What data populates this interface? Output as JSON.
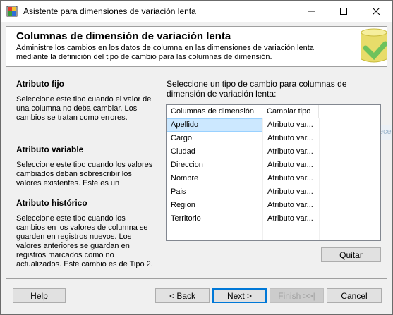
{
  "window": {
    "title": "Asistente para dimensiones de variación lenta"
  },
  "header": {
    "title": "Columnas de dimensión de variación lenta",
    "description": "Administre los cambios en los datos de columna en las dimensiones de variación lenta mediante la definición del tipo de cambio para las columnas de dimensión."
  },
  "left": {
    "fixed": {
      "title": "Atributo fijo",
      "text": "Seleccione este tipo cuando el valor de una columna no deba cambiar. Los cambios se tratan como errores."
    },
    "changing": {
      "title": "Atributo variable",
      "text": "Seleccione este tipo cuando los valores cambiados deban sobrescribir los valores existentes. Este es un"
    },
    "historical": {
      "title": "Atributo histórico",
      "text": "Seleccione este tipo cuando los cambios en los valores de columna se guarden en registros nuevos. Los valores anteriores se guardan en registros marcados como no actualizados. Este cambio es de Tipo 2."
    }
  },
  "right": {
    "instruction": "Seleccione un tipo de cambio para columnas de dimensión de variación lenta:",
    "columns": [
      "Columnas de dimensión",
      "Cambiar tipo"
    ],
    "rows": [
      {
        "name": "Apellido",
        "type": "Atributo var..."
      },
      {
        "name": "Cargo",
        "type": "Atributo var..."
      },
      {
        "name": "Ciudad",
        "type": "Atributo var..."
      },
      {
        "name": "Direccion",
        "type": "Atributo var..."
      },
      {
        "name": "Nombre",
        "type": "Atributo var..."
      },
      {
        "name": "Pais",
        "type": "Atributo var..."
      },
      {
        "name": "Region",
        "type": "Atributo var..."
      },
      {
        "name": "Territorio",
        "type": "Atributo var..."
      }
    ],
    "selected_row": "Apellido",
    "remove_label": "Quitar"
  },
  "footer": {
    "help": "Help",
    "back": "< Back",
    "next": "Next >",
    "finish": "Finish >>|",
    "cancel": "Cancel"
  },
  "background_fragment": "Recen",
  "colors": {
    "selection": "#cce8ff",
    "default_button_border": "#0078d7"
  }
}
